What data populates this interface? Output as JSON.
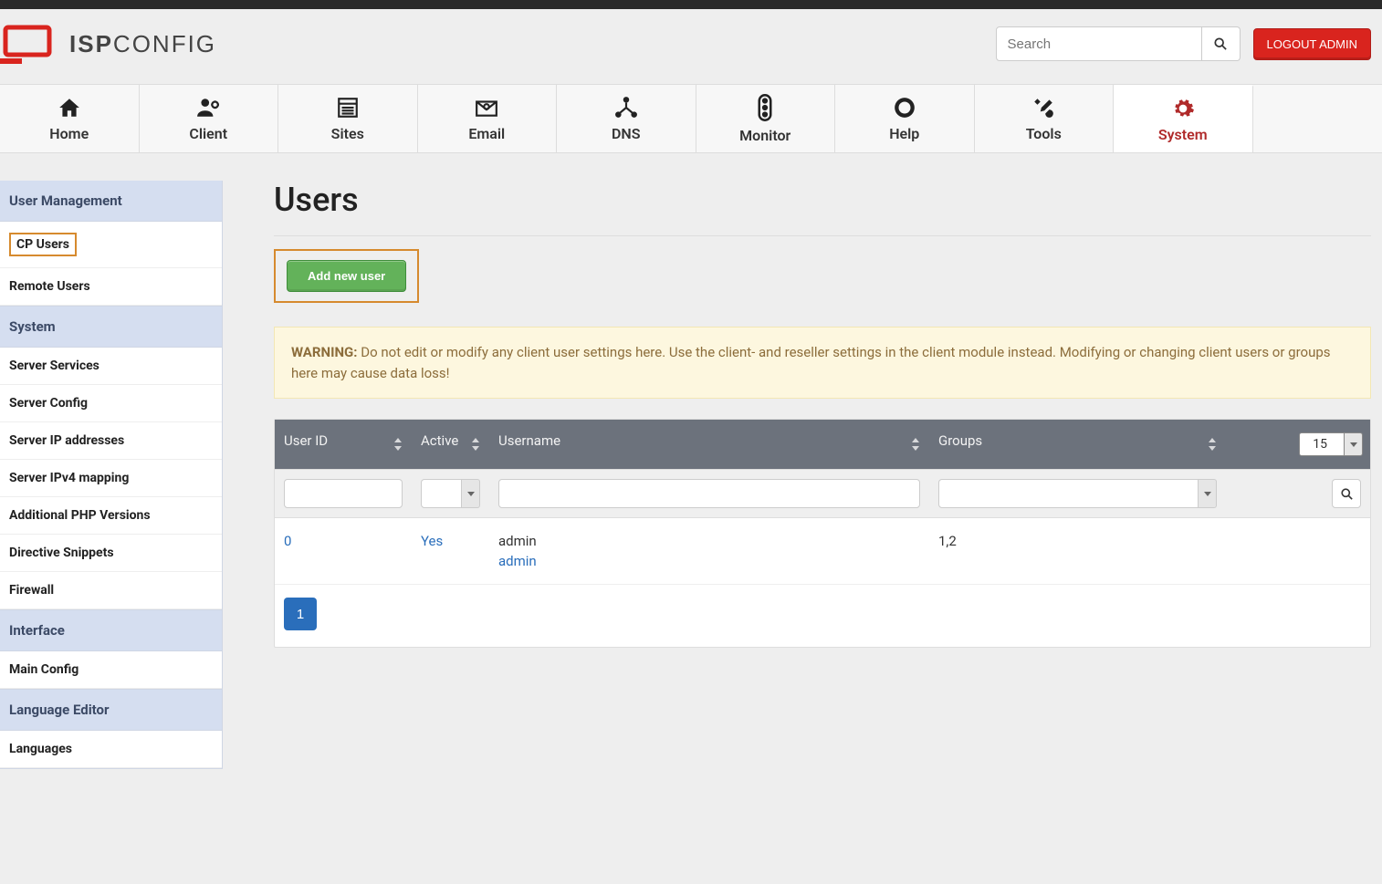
{
  "app": {
    "logo_primary": "ISP",
    "logo_secondary": "CONFIG"
  },
  "topbar": {
    "search_placeholder": "Search",
    "logout_label": "LOGOUT ADMIN"
  },
  "nav": {
    "items": [
      {
        "label": "Home"
      },
      {
        "label": "Client"
      },
      {
        "label": "Sites"
      },
      {
        "label": "Email"
      },
      {
        "label": "DNS"
      },
      {
        "label": "Monitor"
      },
      {
        "label": "Help"
      },
      {
        "label": "Tools"
      },
      {
        "label": "System"
      }
    ]
  },
  "sidebar": {
    "sections": [
      {
        "header": "User Management",
        "items": [
          {
            "label": "CP Users",
            "active": true
          },
          {
            "label": "Remote Users"
          }
        ]
      },
      {
        "header": "System",
        "items": [
          {
            "label": "Server Services"
          },
          {
            "label": "Server Config"
          },
          {
            "label": "Server IP addresses"
          },
          {
            "label": "Server IPv4 mapping"
          },
          {
            "label": "Additional PHP Versions"
          },
          {
            "label": "Directive Snippets"
          },
          {
            "label": "Firewall"
          }
        ]
      },
      {
        "header": "Interface",
        "items": [
          {
            "label": "Main Config"
          }
        ]
      },
      {
        "header": "Language Editor",
        "items": [
          {
            "label": "Languages"
          }
        ]
      }
    ]
  },
  "content": {
    "title": "Users",
    "add_button": "Add new user",
    "warning_prefix": "WARNING:",
    "warning_body": " Do not edit or modify any client user settings here. Use the client- and reseller settings in the client module instead. Modifying or changing client users or groups here may cause data loss!",
    "columns": {
      "id": "User ID",
      "active": "Active",
      "username": "Username",
      "groups": "Groups"
    },
    "page_size": "15",
    "rows": [
      {
        "id": "0",
        "active": "Yes",
        "username": "admin",
        "username_sub": "admin",
        "groups": "1,2"
      }
    ],
    "pagination": {
      "current": "1"
    }
  }
}
